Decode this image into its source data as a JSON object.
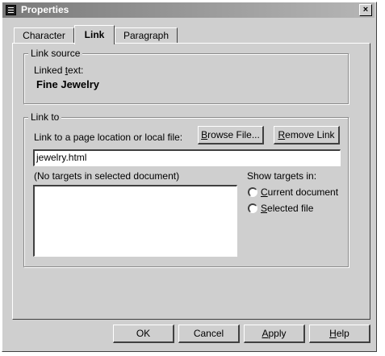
{
  "window": {
    "title": "Properties",
    "close_glyph": "×"
  },
  "tabs": [
    {
      "label": "Character"
    },
    {
      "label": "Link"
    },
    {
      "label": "Paragraph"
    }
  ],
  "link_source": {
    "legend": "Link source",
    "linked_text_label": "Linked text:",
    "linked_text_value": "Fine Jewelry"
  },
  "link_to": {
    "legend": "Link to",
    "prompt": "Link to a page location or local file:",
    "browse_button": "Browse File...",
    "remove_button": "Remove Link",
    "url_value": "jewelry.html",
    "targets_label": "(No targets in selected document)",
    "show_targets_label": "Show targets in:",
    "radio_current": "Current document",
    "radio_selected": "Selected file"
  },
  "buttons": {
    "ok": "OK",
    "cancel": "Cancel",
    "apply": "Apply",
    "help": "Help"
  }
}
